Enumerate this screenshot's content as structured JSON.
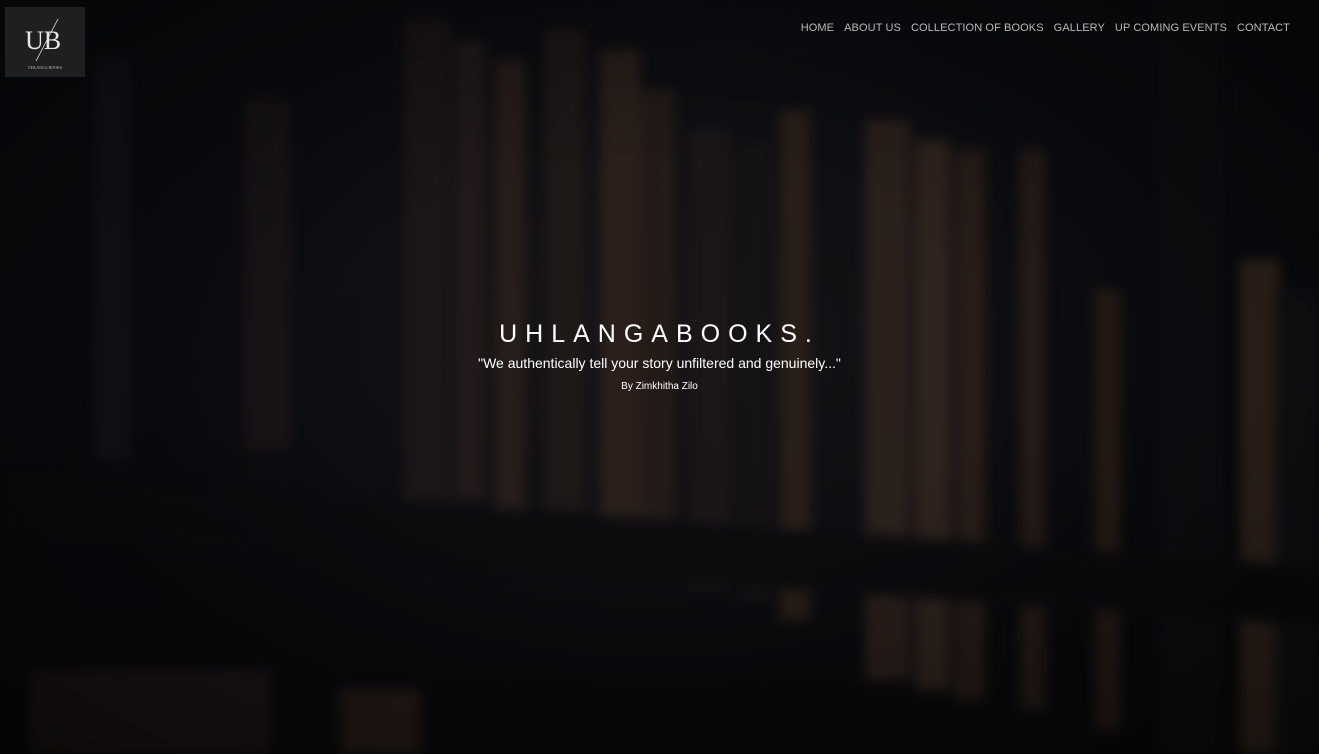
{
  "logo": {
    "initials": "UB",
    "caption": "UHLANGA BOOKS"
  },
  "nav": {
    "items": [
      {
        "label": "HOME"
      },
      {
        "label": "ABOUT US"
      },
      {
        "label": "COLLECTION OF BOOKS"
      },
      {
        "label": "GALLERY"
      },
      {
        "label": "UP COMING EVENTS"
      },
      {
        "label": "CONTACT"
      }
    ]
  },
  "hero": {
    "title": "UHLANGABOOKS.",
    "tagline": "\"We authentically tell your story unfiltered and genuinely...\"",
    "byline": "By Zimkhitha Zilo"
  }
}
